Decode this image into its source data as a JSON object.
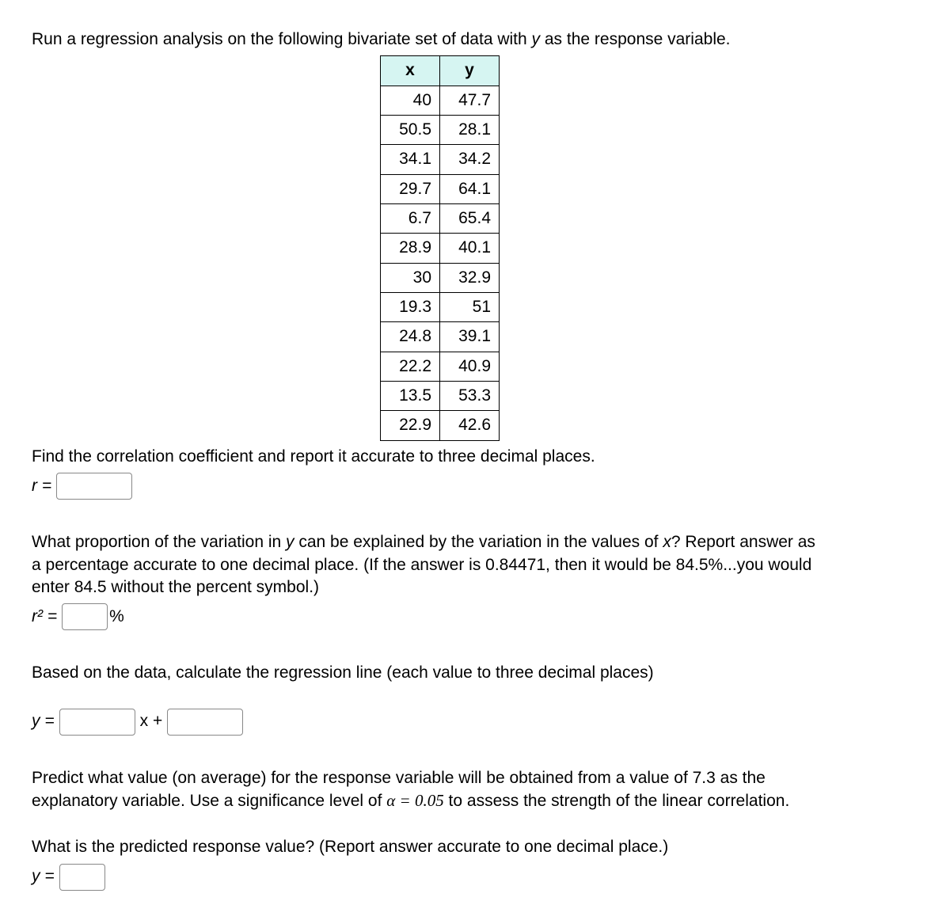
{
  "intro_text": "Run a regression analysis on the following bivariate set of data with ",
  "intro_text_2": " as the response variable.",
  "response_var": "y",
  "table": {
    "headers": {
      "x": "x",
      "y": "y"
    },
    "rows": [
      {
        "x": "40",
        "y": "47.7"
      },
      {
        "x": "50.5",
        "y": "28.1"
      },
      {
        "x": "34.1",
        "y": "34.2"
      },
      {
        "x": "29.7",
        "y": "64.1"
      },
      {
        "x": "6.7",
        "y": "65.4"
      },
      {
        "x": "28.9",
        "y": "40.1"
      },
      {
        "x": "30",
        "y": "32.9"
      },
      {
        "x": "19.3",
        "y": "51"
      },
      {
        "x": "24.8",
        "y": "39.1"
      },
      {
        "x": "22.2",
        "y": "40.9"
      },
      {
        "x": "13.5",
        "y": "53.3"
      },
      {
        "x": "22.9",
        "y": "42.6"
      }
    ]
  },
  "q_correlation": "Find the correlation coefficient and report it accurate to three decimal places.",
  "r_label": "r =",
  "q_proportion_1": "What proportion of the variation in ",
  "q_proportion_2": " can be explained by the variation in the values of ",
  "q_proportion_3": "? Report answer as a percentage accurate to one decimal place.  (If the answer is 0.84471, then it would be 84.5%...you would enter 84.5 without the percent symbol.)",
  "r2_label": "r² =",
  "percent_symbol": "%",
  "q_regression": "Based on the data, calculate the regression line (each value to three decimal places)",
  "y_eq_label": "y =",
  "x_plus": "x +",
  "q_predict_1": "Predict what value (on average) for the response variable will be obtained from a value of 7.3 as the explanatory variable. Use a significance level of ",
  "alpha_eq": "α = 0.05",
  "q_predict_2": " to assess the strength of the linear correlation.",
  "q_predicted_response": "What is the predicted response value?  (Report answer accurate to one decimal place.)",
  "y_label": "y ="
}
